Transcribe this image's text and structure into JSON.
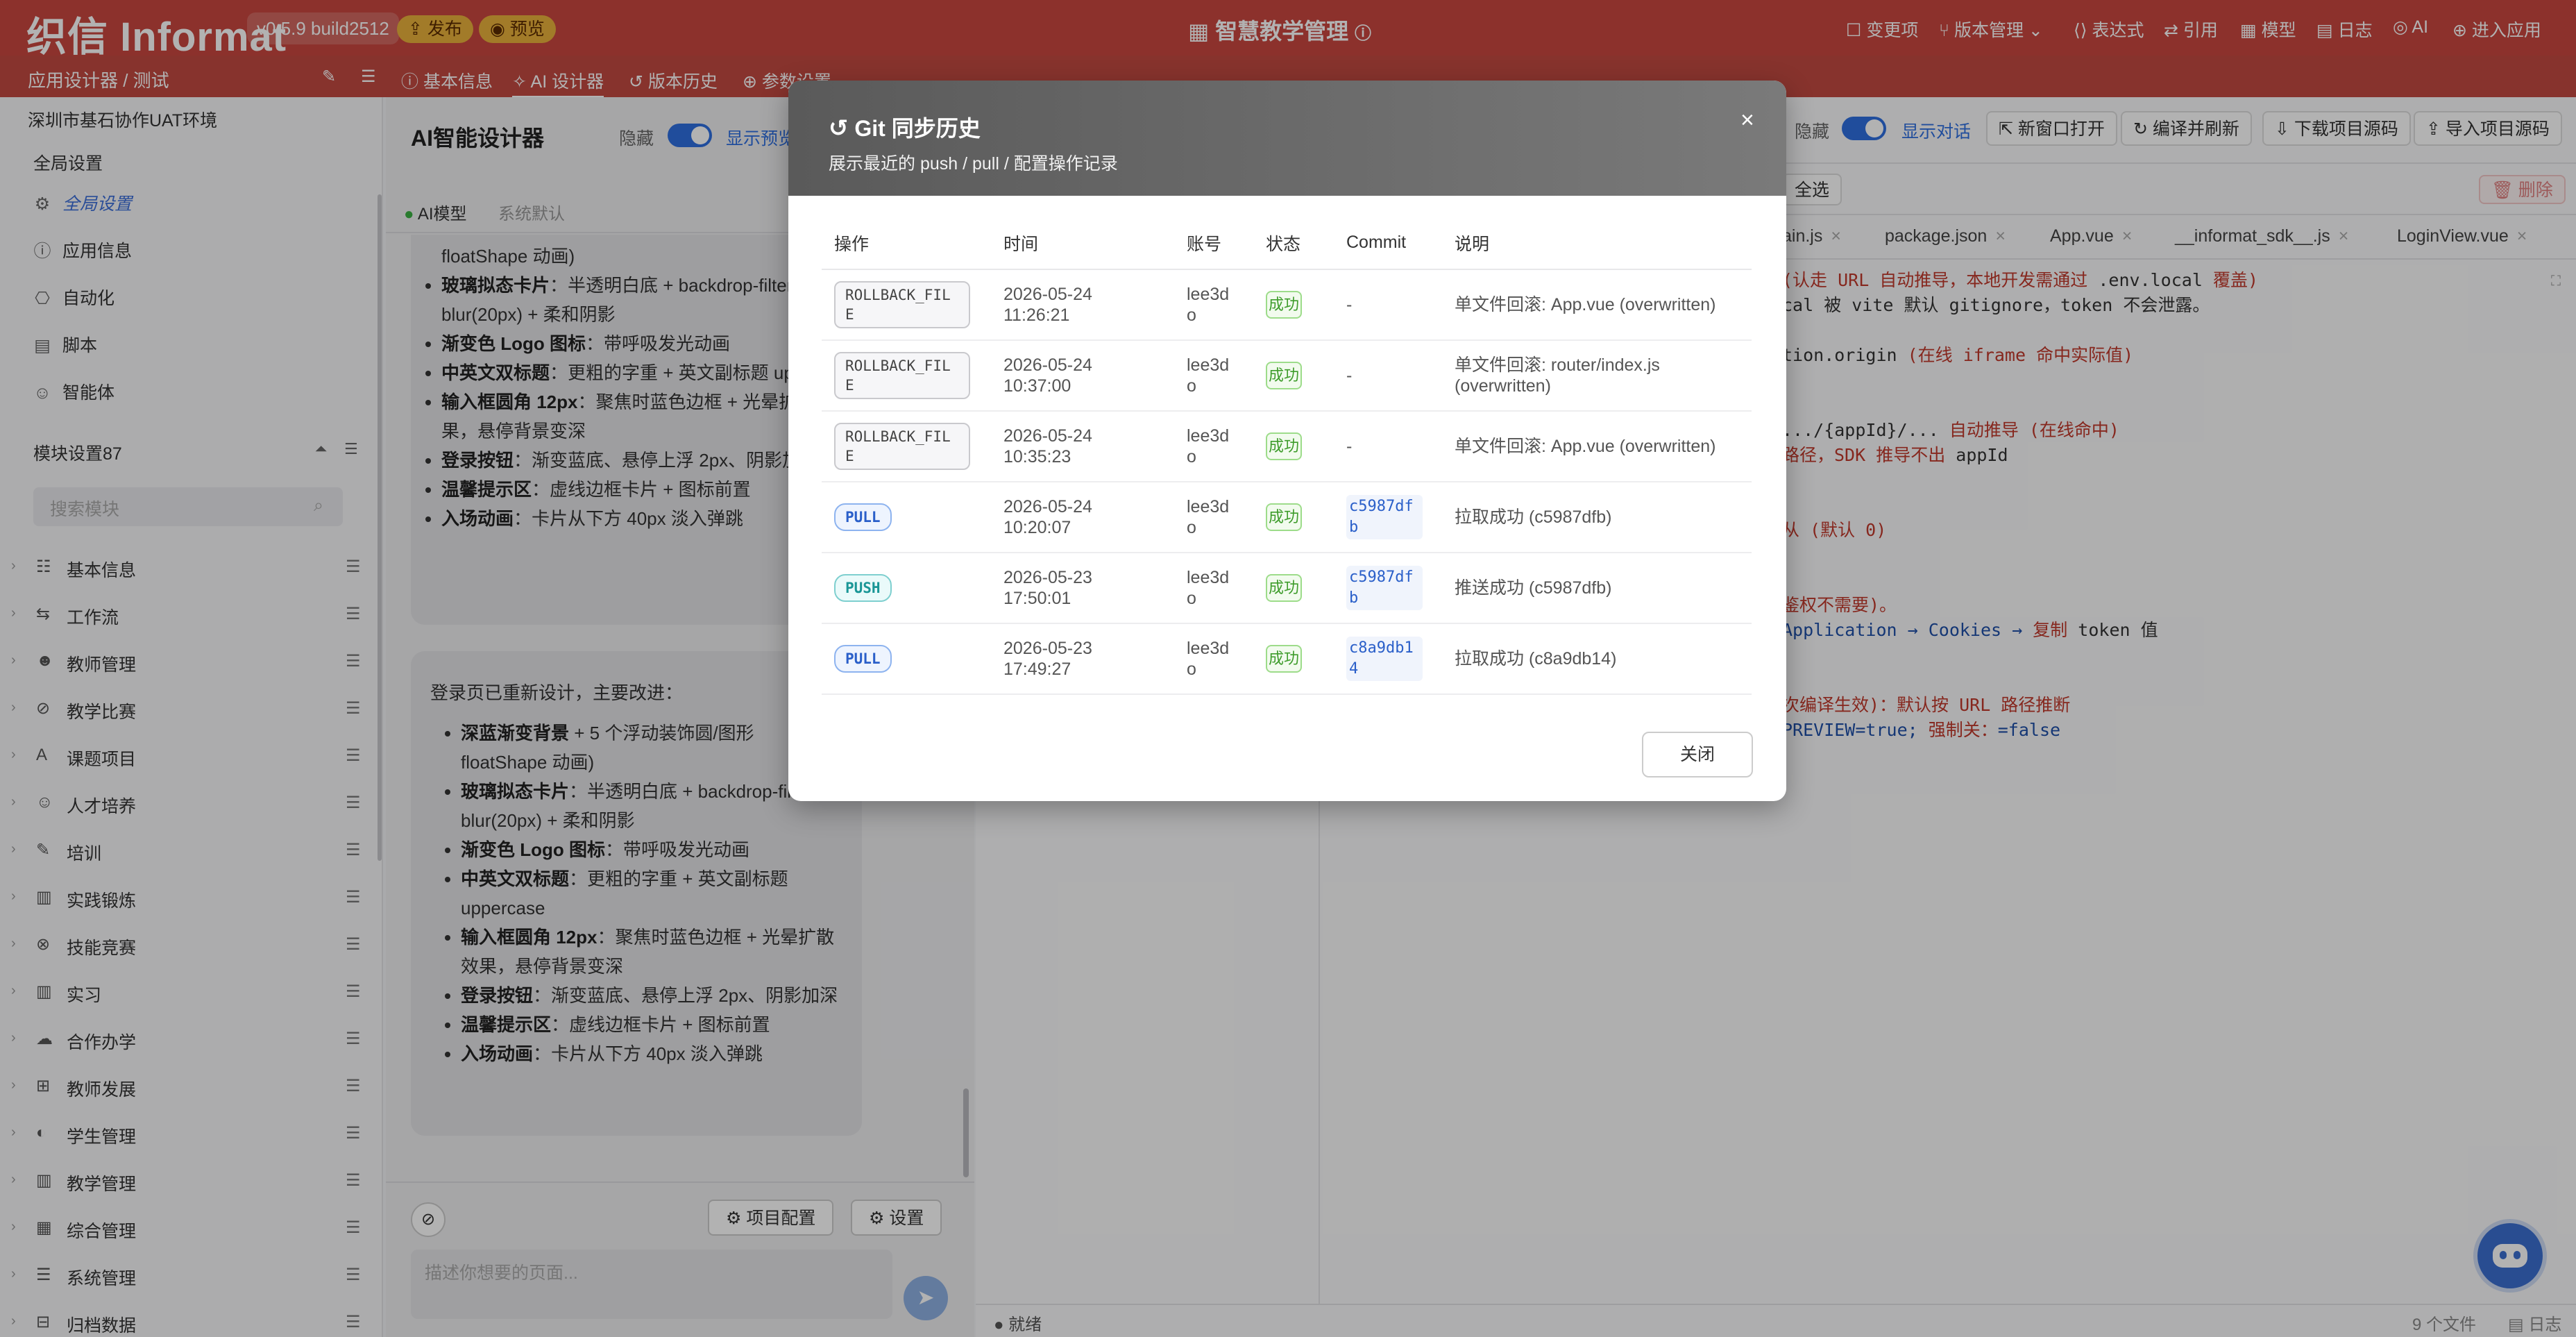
{
  "header": {
    "logo": "织信 Informat",
    "version": "v0.5.9 build2512",
    "publish_label": "发布",
    "preview_label": "预览",
    "app_title": "智慧教学管理",
    "links": [
      "变更项",
      "版本管理",
      "表达式",
      "引用",
      "模型",
      "日志",
      "AI",
      "进入应用"
    ]
  },
  "subheader": {
    "breadcrumb": "应用设计器 / 测试",
    "tabs": [
      "基本信息",
      "AI 设计器",
      "版本历史",
      "参数设置"
    ]
  },
  "sidebar": {
    "env": "深圳市基石协作UAT环境",
    "global_section": "全局设置",
    "global_items": [
      {
        "label": "全局设置",
        "icon": "gear-icon"
      },
      {
        "label": "应用信息",
        "icon": "info-icon"
      },
      {
        "label": "自动化",
        "icon": "robot-icon"
      },
      {
        "label": "脚本",
        "icon": "script-icon"
      },
      {
        "label": "智能体",
        "icon": "agent-icon"
      }
    ],
    "modules_title": "模块设置87",
    "search_placeholder": "搜索模块",
    "modules": [
      "基本信息",
      "工作流",
      "教师管理",
      "教学比赛",
      "课题项目",
      "人才培养",
      "培训",
      "实践锻炼",
      "技能竞赛",
      "实习",
      "合作办学",
      "教师发展",
      "学生管理",
      "教学管理",
      "综合管理",
      "系统管理",
      "归档数据"
    ]
  },
  "chat": {
    "title": "AI智能设计器",
    "hide_label": "隐藏",
    "show_preview_label": "显示预览",
    "model_label": "AI模型",
    "model_value": "系统默认",
    "partial_items": [
      {
        "bold": "",
        "text": "floatShape 动画)"
      },
      {
        "bold": "玻璃拟态卡片",
        "text": "：半透明白底 + backdrop-filter: blur(20px) + 柔和阴影"
      },
      {
        "bold": "渐变色 Logo 图标",
        "text": "：带呼吸发光动画"
      },
      {
        "bold": "中英文双标题",
        "text": "：更粗的字重 + 英文副标题 uppercase"
      },
      {
        "bold": "输入框圆角 12px",
        "text": "：聚焦时蓝色边框 + 光晕扩散效果，悬停背景变深"
      },
      {
        "bold": "登录按钮",
        "text": "：渐变蓝底、悬停上浮 2px、阴影加深"
      },
      {
        "bold": "温馨提示区",
        "text": "：虚线边框卡片 + 图标前置"
      },
      {
        "bold": "入场动画",
        "text": "：卡片从下方 40px 淡入弹跳"
      }
    ],
    "message_intro": "登录页已重新设计，主要改进：",
    "message_items": [
      {
        "bold": "深蓝渐变背景",
        "text": " + 5 个浮动装饰圆/图形 floatShape 动画)"
      },
      {
        "bold": "玻璃拟态卡片",
        "text": "：半透明白底 + backdrop-filter: blur(20px) + 柔和阴影"
      },
      {
        "bold": "渐变色 Logo 图标",
        "text": "：带呼吸发光动画"
      },
      {
        "bold": "中英文双标题",
        "text": "：更粗的字重 + 英文副标题 uppercase"
      },
      {
        "bold": "输入框圆角 12px",
        "text": "：聚焦时蓝色边框 + 光晕扩散效果，悬停背景变深"
      },
      {
        "bold": "登录按钮",
        "text": "：渐变蓝底、悬停上浮 2px、阴影加深"
      },
      {
        "bold": "温馨提示区",
        "text": "：虚线边框卡片 + 图标前置"
      },
      {
        "bold": "入场动画",
        "text": "：卡片从下方 40px 淡入弹跳"
      }
    ],
    "project_config_label": "项目配置",
    "settings_label": "设置",
    "input_placeholder": "描述你想要的页面..."
  },
  "editor": {
    "hide_label": "隐藏",
    "show_dialog_label": "显示对话",
    "toolbar": [
      "新窗口打开",
      "编译并刷新",
      "下载项目源码",
      "导入项目源码"
    ],
    "select_all_label": "全选",
    "delete_label": "删除",
    "file_tabs": [
      "ain.js",
      "package.json",
      "App.vue",
      "__informat_sdk__.js",
      "LoginView.vue"
    ],
    "code_lines": [
      {
        "parts": [
          {
            "c": "r",
            "t": "(认走 URL 自动推导，本地开发需通过 "
          },
          {
            "c": "",
            "t": ".env.local"
          },
          {
            "c": "r",
            "t": " 覆盖)"
          }
        ]
      },
      {
        "parts": [
          {
            "c": "",
            "t": "cal 被 vite 默认 gitignore，token 不会泄露。"
          }
        ]
      },
      {
        "parts": [
          {
            "c": "",
            "t": ""
          }
        ]
      },
      {
        "parts": [
          {
            "c": "",
            "t": "tion.origin "
          },
          {
            "c": "r",
            "t": "(在线 iframe 命中实际值)"
          }
        ]
      },
      {
        "parts": [
          {
            "c": "",
            "t": ""
          }
        ]
      },
      {
        "parts": [
          {
            "c": "",
            "t": ""
          }
        ]
      },
      {
        "parts": [
          {
            "c": "",
            "t": ".../{appId}/... "
          },
          {
            "c": "r",
            "t": "自动推导 (在线命中)"
          }
        ]
      },
      {
        "parts": [
          {
            "c": "r",
            "t": "路径，SDK 推导不出 "
          },
          {
            "c": "",
            "t": "appId"
          }
        ]
      },
      {
        "parts": [
          {
            "c": "",
            "t": ""
          }
        ]
      },
      {
        "parts": [
          {
            "c": "",
            "t": ""
          }
        ]
      },
      {
        "parts": [
          {
            "c": "r",
            "t": "从 (默认 0)"
          }
        ]
      },
      {
        "parts": [
          {
            "c": "",
            "t": ""
          }
        ]
      },
      {
        "parts": [
          {
            "c": "",
            "t": ""
          }
        ]
      },
      {
        "parts": [
          {
            "c": "r",
            "t": "鉴权不需要)。"
          }
        ]
      },
      {
        "parts": [
          {
            "c": "b",
            "t": "Application → Cookies → "
          },
          {
            "c": "r",
            "t": "复制 "
          },
          {
            "c": "",
            "t": "token 值"
          }
        ]
      },
      {
        "parts": [
          {
            "c": "",
            "t": ""
          }
        ]
      },
      {
        "parts": [
          {
            "c": "",
            "t": ""
          }
        ]
      },
      {
        "parts": [
          {
            "c": "r",
            "t": "次编译生效)：默认按 URL 路径推断"
          }
        ]
      },
      {
        "parts": [
          {
            "c": "b",
            "t": "PREVIEW=true; "
          },
          {
            "c": "r",
            "t": "强制关："
          },
          {
            "c": "b",
            "t": "=false"
          }
        ]
      }
    ],
    "status_ready": "就绪",
    "file_count": "9 个文件",
    "log_label": "日志"
  },
  "dialog": {
    "title": "Git 同步历史",
    "subtitle": "展示最近的 push / pull / 配置操作记录",
    "columns": [
      "操作",
      "时间",
      "账号",
      "状态",
      "Commit",
      "说明"
    ],
    "rows": [
      {
        "op": "ROLLBACK_FILE",
        "kind": "rollback",
        "time": "2026-05-24 11:26:21",
        "account": "lee3do",
        "status": "成功",
        "commit": "-",
        "desc": "单文件回滚: App.vue (overwritten)"
      },
      {
        "op": "ROLLBACK_FILE",
        "kind": "rollback",
        "time": "2026-05-24 10:37:00",
        "account": "lee3do",
        "status": "成功",
        "commit": "-",
        "desc": "单文件回滚: router/index.js (overwritten)"
      },
      {
        "op": "ROLLBACK_FILE",
        "kind": "rollback",
        "time": "2026-05-24 10:35:23",
        "account": "lee3do",
        "status": "成功",
        "commit": "-",
        "desc": "单文件回滚: App.vue (overwritten)"
      },
      {
        "op": "PULL",
        "kind": "pull",
        "time": "2026-05-24 10:20:07",
        "account": "lee3do",
        "status": "成功",
        "commit": "c5987dfb",
        "desc": "拉取成功 (c5987dfb)"
      },
      {
        "op": "PUSH",
        "kind": "push",
        "time": "2026-05-23 17:50:01",
        "account": "lee3do",
        "status": "成功",
        "commit": "c5987dfb",
        "desc": "推送成功 (c5987dfb)"
      },
      {
        "op": "PULL",
        "kind": "pull",
        "time": "2026-05-23 17:49:27",
        "account": "lee3do",
        "status": "成功",
        "commit": "c8a9db14",
        "desc": "拉取成功 (c8a9db14)"
      }
    ],
    "close_label": "关闭"
  }
}
